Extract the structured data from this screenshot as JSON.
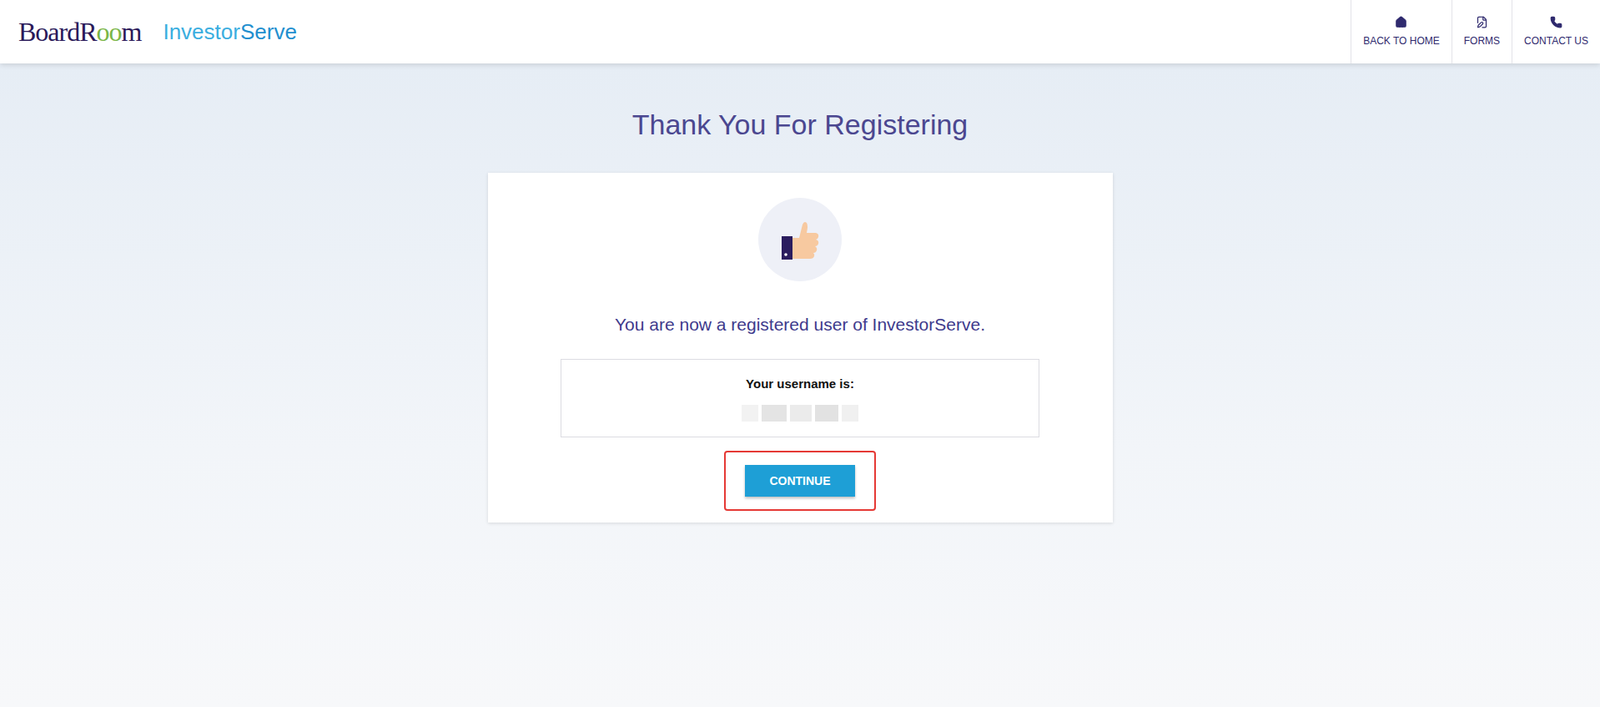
{
  "header": {
    "logo": [
      {
        "text": "BoardR",
        "color": "#2b1a5a"
      },
      {
        "text": "oo",
        "color": "#7ab648"
      },
      {
        "text": "m",
        "color": "#2b1a5a"
      }
    ],
    "product": [
      {
        "text": "Investor",
        "color": "#3aaee0"
      },
      {
        "text": "Serve",
        "color": "#1f8fcf"
      }
    ],
    "nav": [
      {
        "label": "BACK TO HOME",
        "icon": "home"
      },
      {
        "label": "FORMS",
        "icon": "forms"
      },
      {
        "label": "CONTACT US",
        "icon": "phone"
      }
    ]
  },
  "page": {
    "title": "Thank You For Registering"
  },
  "card": {
    "message": "You are now a registered user of InvestorServe.",
    "username": {
      "label": "Your username is:",
      "redacted": true
    },
    "button": {
      "label": "CONTINUE",
      "highlighted": true
    }
  }
}
